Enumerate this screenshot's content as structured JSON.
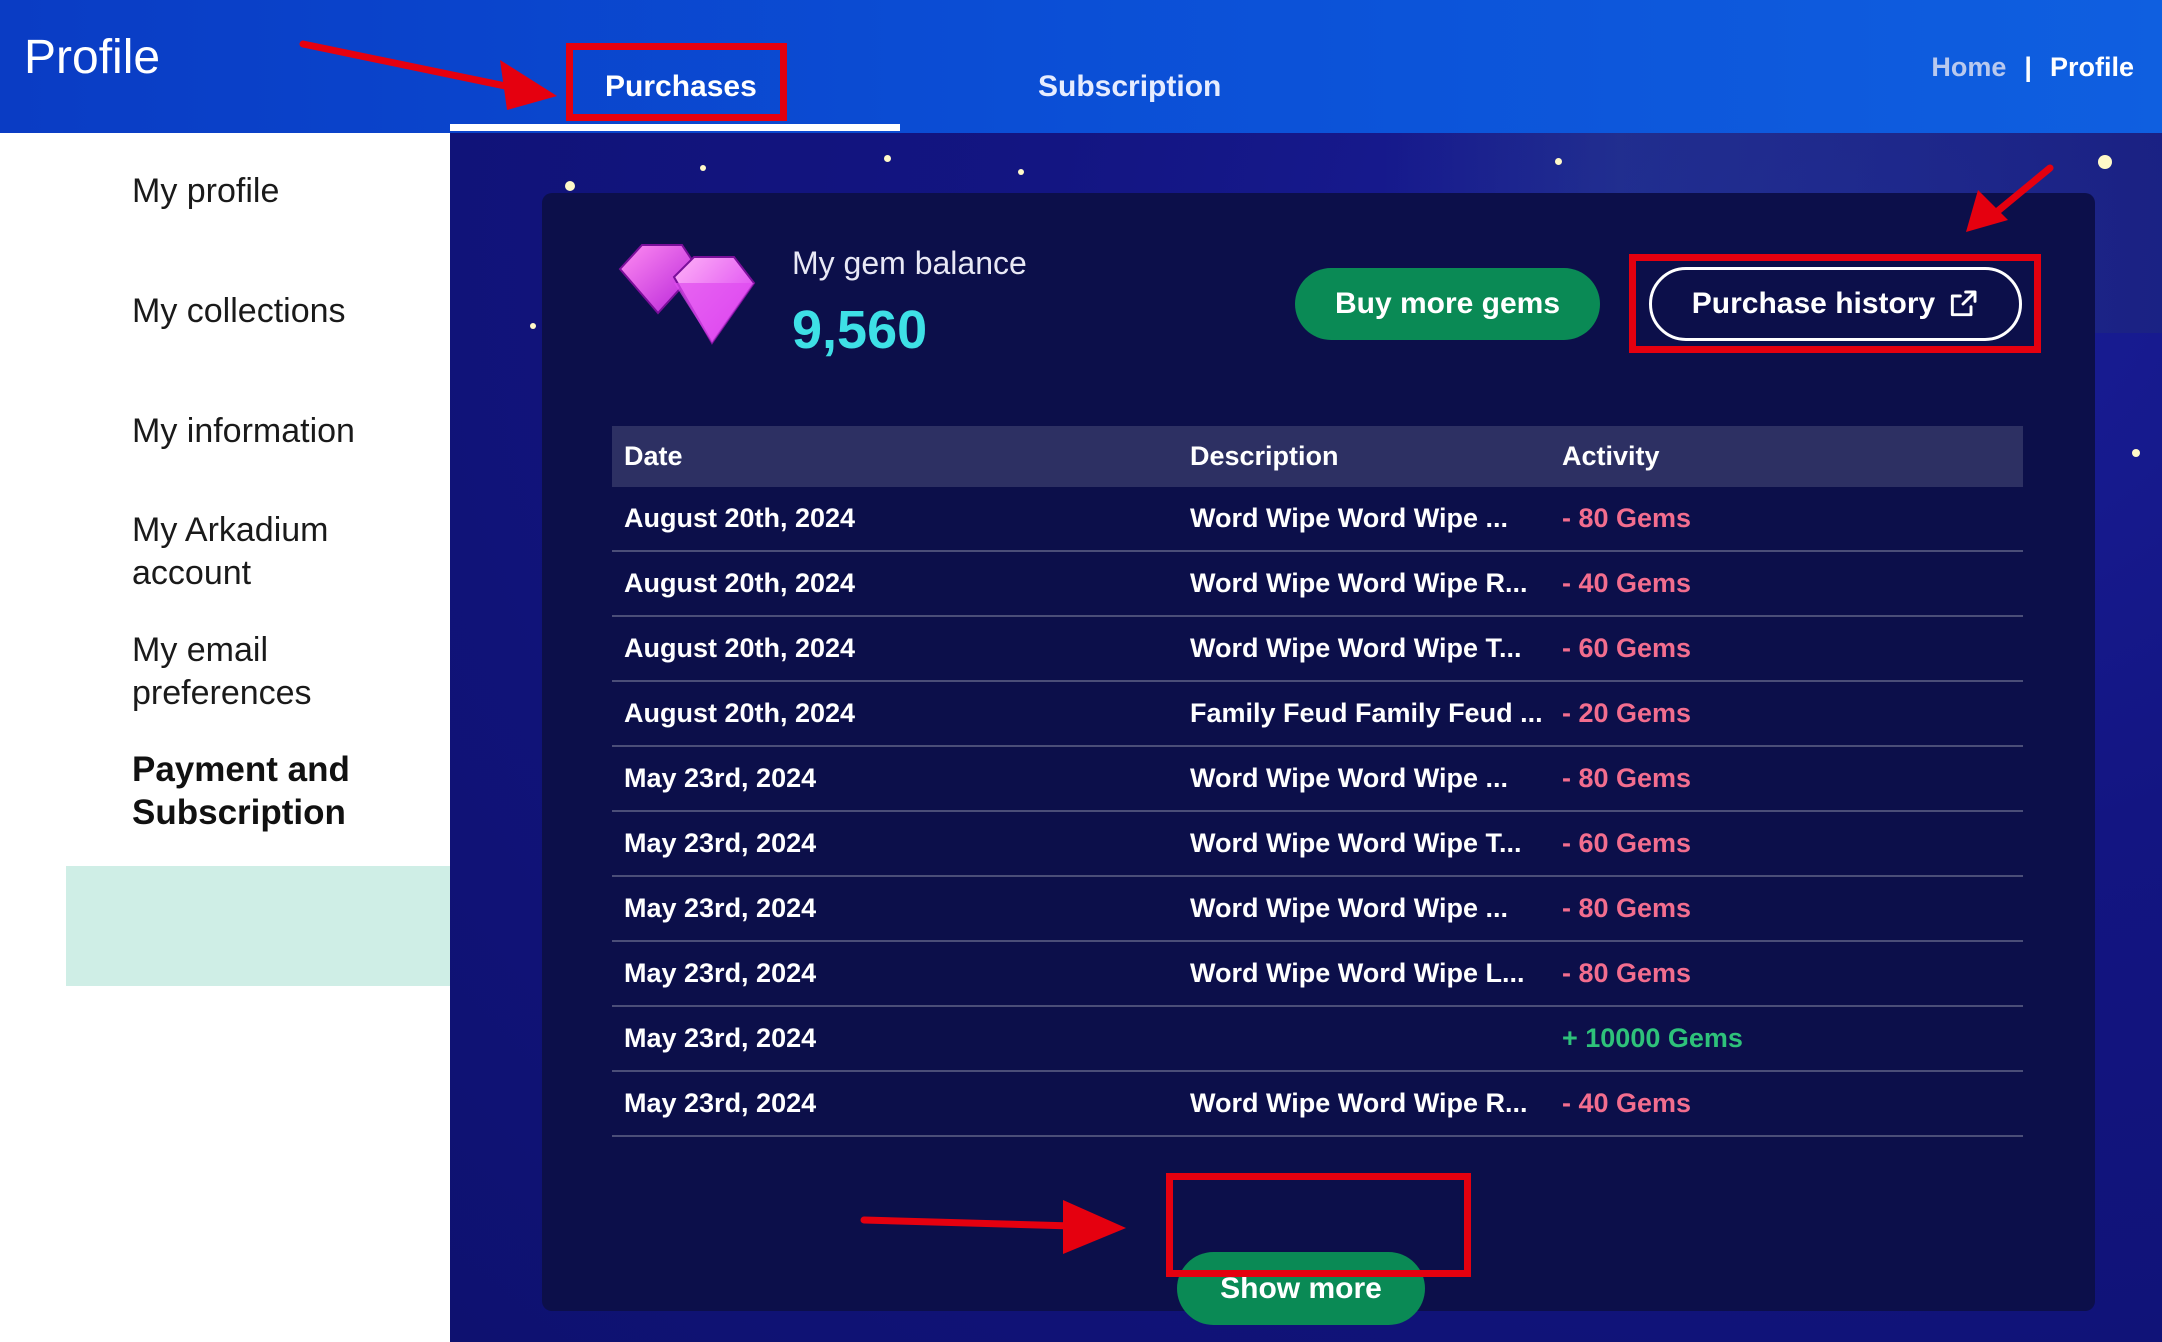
{
  "header": {
    "page_title": "Profile",
    "tabs": [
      {
        "label": "Purchases",
        "active": true
      },
      {
        "label": "Subscription",
        "active": false
      }
    ],
    "breadcrumb": {
      "home": "Home",
      "separator": "|",
      "current": "Profile"
    }
  },
  "sidebar": {
    "items": [
      {
        "label": "My profile"
      },
      {
        "label": "My collections"
      },
      {
        "label": "My information"
      },
      {
        "label": "My Arkadium account"
      },
      {
        "label": "My email preferences"
      },
      {
        "label": "Payment and Subscription",
        "active": true
      }
    ]
  },
  "balance": {
    "label": "My gem balance",
    "value": "9,560",
    "gem_icon": "gem-icon",
    "buy_button": "Buy more gems",
    "history_button": "Purchase history",
    "history_icon": "external-link-icon"
  },
  "table": {
    "headers": [
      "Date",
      "Description",
      "Activity"
    ],
    "rows": [
      {
        "date": "August 20th, 2024",
        "description": "Word Wipe Word Wipe ...",
        "activity": "- 80 Gems",
        "type": "neg"
      },
      {
        "date": "August 20th, 2024",
        "description": "Word Wipe Word Wipe R...",
        "activity": "- 40 Gems",
        "type": "neg"
      },
      {
        "date": "August 20th, 2024",
        "description": "Word Wipe Word Wipe T...",
        "activity": "- 60 Gems",
        "type": "neg"
      },
      {
        "date": "August 20th, 2024",
        "description": "Family Feud Family Feud ...",
        "activity": "- 20 Gems",
        "type": "neg"
      },
      {
        "date": "May 23rd, 2024",
        "description": "Word Wipe Word Wipe ...",
        "activity": "- 80 Gems",
        "type": "neg"
      },
      {
        "date": "May 23rd, 2024",
        "description": "Word Wipe Word Wipe T...",
        "activity": "- 60 Gems",
        "type": "neg"
      },
      {
        "date": "May 23rd, 2024",
        "description": "Word Wipe Word Wipe ...",
        "activity": "- 80 Gems",
        "type": "neg"
      },
      {
        "date": "May 23rd, 2024",
        "description": "Word Wipe Word Wipe L...",
        "activity": "- 80 Gems",
        "type": "neg"
      },
      {
        "date": "May 23rd, 2024",
        "description": "",
        "activity": "+ 10000 Gems",
        "type": "pos"
      },
      {
        "date": "May 23rd, 2024",
        "description": "Word Wipe Word Wipe R...",
        "activity": "- 40 Gems",
        "type": "neg"
      }
    ]
  },
  "show_more_button": "Show more",
  "colors": {
    "header_blue": "#0b4fd6",
    "main_bg": "#131582",
    "card_bg": "#0c0f4a",
    "accent_green": "#0a8a55",
    "balance_cyan": "#3ee0e6",
    "negative": "#f36d8e",
    "positive": "#2ec27a",
    "active_sidebar": "#cfeee6",
    "annotation_red": "#e5000f"
  }
}
